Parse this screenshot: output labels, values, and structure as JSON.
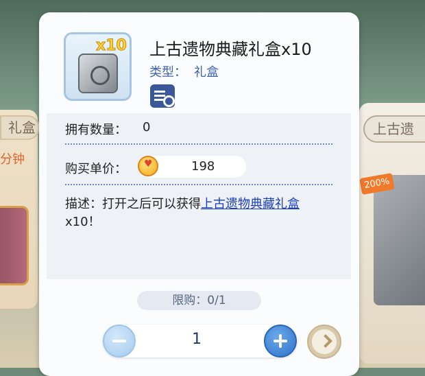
{
  "background": {
    "left_tag": "礼盒",
    "left_timer": "分钟",
    "right_tag": "上古遗",
    "right_badge": "200%"
  },
  "item": {
    "badge": "x10",
    "title": "上古遗物典藏礼盒x10",
    "type_label": "类型：",
    "type_value": "礼盒",
    "icon": "gift-box-icon"
  },
  "info": {
    "owned_label": "拥有数量：",
    "owned_value": "0",
    "price_label": "购买单价：",
    "price_value": "198",
    "price_icon": "coin-icon",
    "desc_prefix": "描述：打开之后可以获得",
    "desc_link": "上古遗物典藏礼盒",
    "desc_suffix": "x10！"
  },
  "purchase": {
    "limit": "限购：0/1",
    "quantity": "1"
  }
}
